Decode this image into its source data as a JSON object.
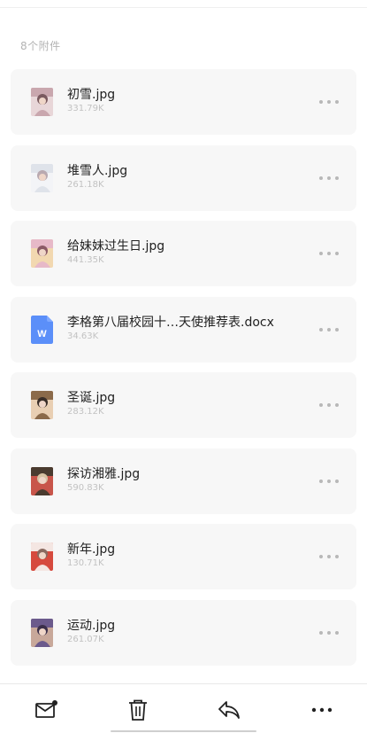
{
  "section": {
    "header": "8个附件"
  },
  "attachments": [
    {
      "name": "初雪.jpg",
      "size": "331.79K",
      "thumb": "photo-icon",
      "colors": [
        "#c9a7ae",
        "#e8d6d8",
        "#7a5a5f"
      ]
    },
    {
      "name": "堆雪人.jpg",
      "size": "261.18K",
      "thumb": "photo-icon",
      "colors": [
        "#dfe3ea",
        "#f3f4f7",
        "#b9a9b0"
      ]
    },
    {
      "name": "给妹妹过生日.jpg",
      "size": "441.35K",
      "thumb": "photo-icon",
      "colors": [
        "#e7b9c8",
        "#f2d8b0",
        "#8b5a66"
      ]
    },
    {
      "name": "李格第八届校园十…天使推荐表.docx",
      "size": "34.63K",
      "thumb": "word-doc-icon",
      "colors": [
        "#5b8ff9",
        "#7ea8ff",
        "#ffffff"
      ]
    },
    {
      "name": "圣诞.jpg",
      "size": "283.12K",
      "thumb": "photo-icon",
      "colors": [
        "#8b6a4a",
        "#e9cfb3",
        "#3a2e28"
      ]
    },
    {
      "name": "探访湘雅.jpg",
      "size": "590.83K",
      "thumb": "photo-icon",
      "colors": [
        "#4a3b2f",
        "#c8554a",
        "#d6c2a3"
      ]
    },
    {
      "name": "新年.jpg",
      "size": "130.71K",
      "thumb": "photo-icon",
      "colors": [
        "#f4e6e2",
        "#d64a3e",
        "#8a6a60"
      ]
    },
    {
      "name": "运动.jpg",
      "size": "261.07K",
      "thumb": "photo-icon",
      "colors": [
        "#6b5a8c",
        "#c8a89a",
        "#3b2f4a"
      ]
    }
  ],
  "toolbar": {
    "items": [
      {
        "name": "mail-icon"
      },
      {
        "name": "trash-icon"
      },
      {
        "name": "reply-icon"
      },
      {
        "name": "more-icon"
      }
    ]
  },
  "colors": {
    "card_bg": "#f7f7f7",
    "text_primary": "#222222",
    "text_secondary": "#c2c2c2",
    "word_blue": "#5b8ff9",
    "notification_dot": "#222222"
  }
}
